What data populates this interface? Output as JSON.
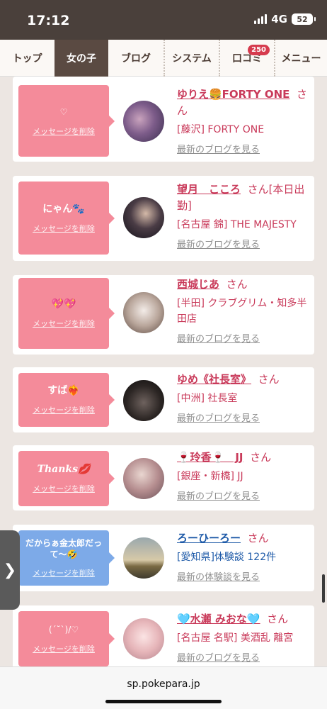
{
  "status": {
    "time": "17:12",
    "network": "4G",
    "battery": "52"
  },
  "nav": [
    {
      "label": "トップ",
      "active": false
    },
    {
      "label": "女の子",
      "active": true
    },
    {
      "label": "ブログ",
      "active": false
    },
    {
      "label": "システム",
      "active": false
    },
    {
      "label": "口コミ",
      "active": false,
      "badge": "250"
    },
    {
      "label": "メニュー",
      "active": false
    }
  ],
  "delete_label": "メッセージを削除",
  "cards": [
    {
      "message": "♡",
      "name": "ゆりえ🍔FORTY ONE",
      "suffix": "さん",
      "shop": "[藤沢] FORTY ONE",
      "link": "最新のブログを見る",
      "color": "pink"
    },
    {
      "message": "にゃん🐾",
      "name": "望月　こころ",
      "suffix": "さん[本日出勤]",
      "shop": "[名古屋 錦] THE MAJESTY",
      "link": "最新のブログを見る",
      "color": "pink"
    },
    {
      "message": "💖💖",
      "name": "西城じあ",
      "suffix": "さん",
      "shop": "[半田] クラブグリム・知多半田店",
      "link": "最新のブログを見る",
      "color": "pink"
    },
    {
      "message": "すば❤️‍🔥",
      "name": "ゆめ《社長室》",
      "suffix": "さん",
      "shop": "[中洲] 社長室",
      "link": "最新のブログを見る",
      "color": "pink"
    },
    {
      "message": "Thanks💋",
      "name": "🍷玲香🍷　JJ",
      "suffix": "さん",
      "shop": "[銀座・新橋] JJ",
      "link": "最新のブログを見る",
      "color": "pink"
    },
    {
      "message": "だからぁ金太郎だって〜🤣",
      "name": "ろーひーろー",
      "suffix": "さん",
      "shop": "[愛知県]体験談 122件",
      "link": "最新の体験談を見る",
      "color": "blue"
    },
    {
      "message": "(´˘`)/♡",
      "name": "🩵水瀬 みおな🩵",
      "suffix": "さん",
      "shop": "[名古屋 名駅] 美酒乱 離宮",
      "link": "最新のブログを見る",
      "color": "pink"
    }
  ],
  "side_tab": "❯",
  "url": "sp.pokepara.jp"
}
